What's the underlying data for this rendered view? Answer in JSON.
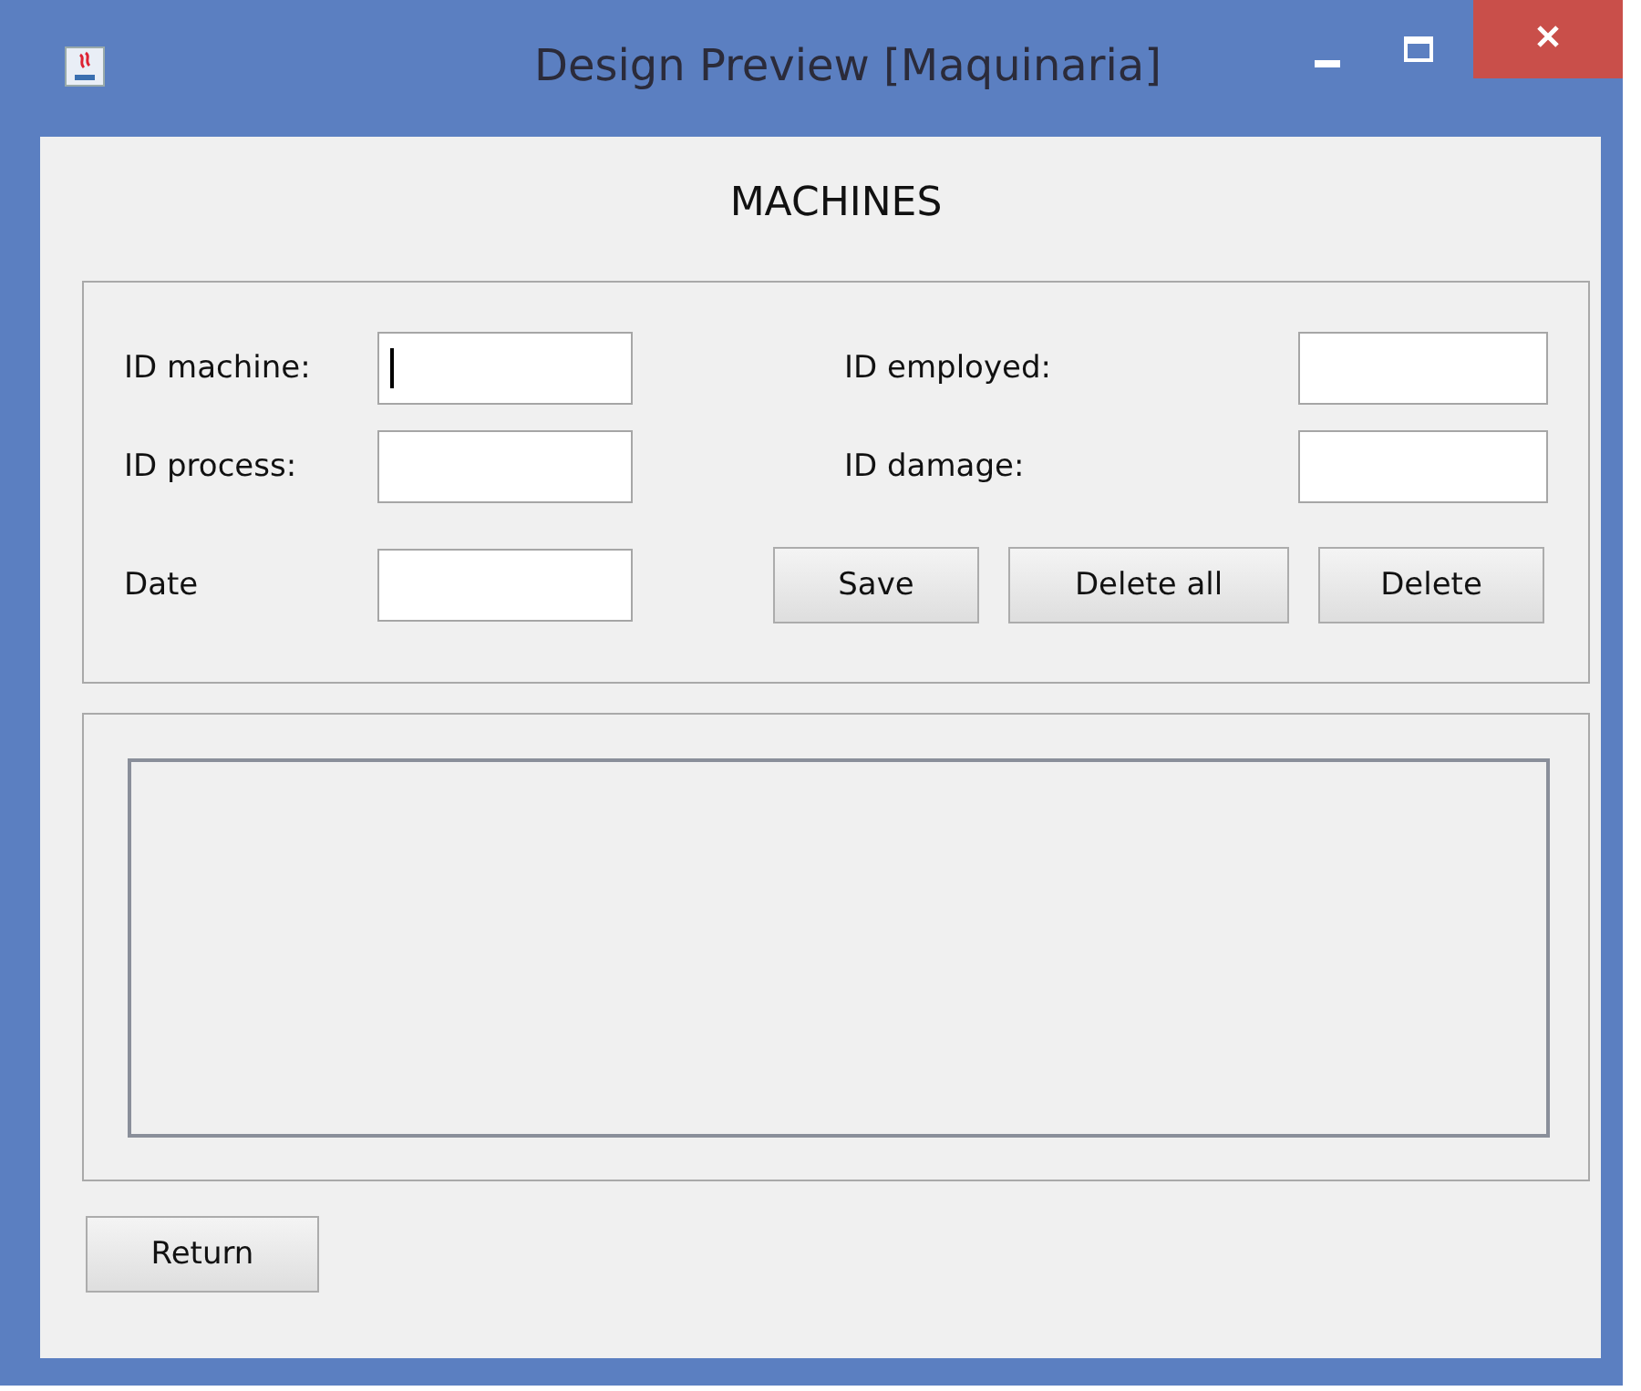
{
  "window": {
    "title": "Design Preview [Maquinaria]"
  },
  "heading": "MACHINES",
  "form": {
    "rows": [
      [
        {
          "label": "ID machine:",
          "focused": true
        },
        {
          "label": "ID employed:",
          "focused": false
        }
      ],
      [
        {
          "label": "ID process:",
          "focused": false
        },
        {
          "label": "ID damage:",
          "focused": false
        }
      ],
      [
        {
          "label": "Date",
          "focused": false
        }
      ]
    ],
    "buttons": [
      "Save",
      "Delete all",
      "Delete"
    ]
  },
  "return_button": "Return"
}
